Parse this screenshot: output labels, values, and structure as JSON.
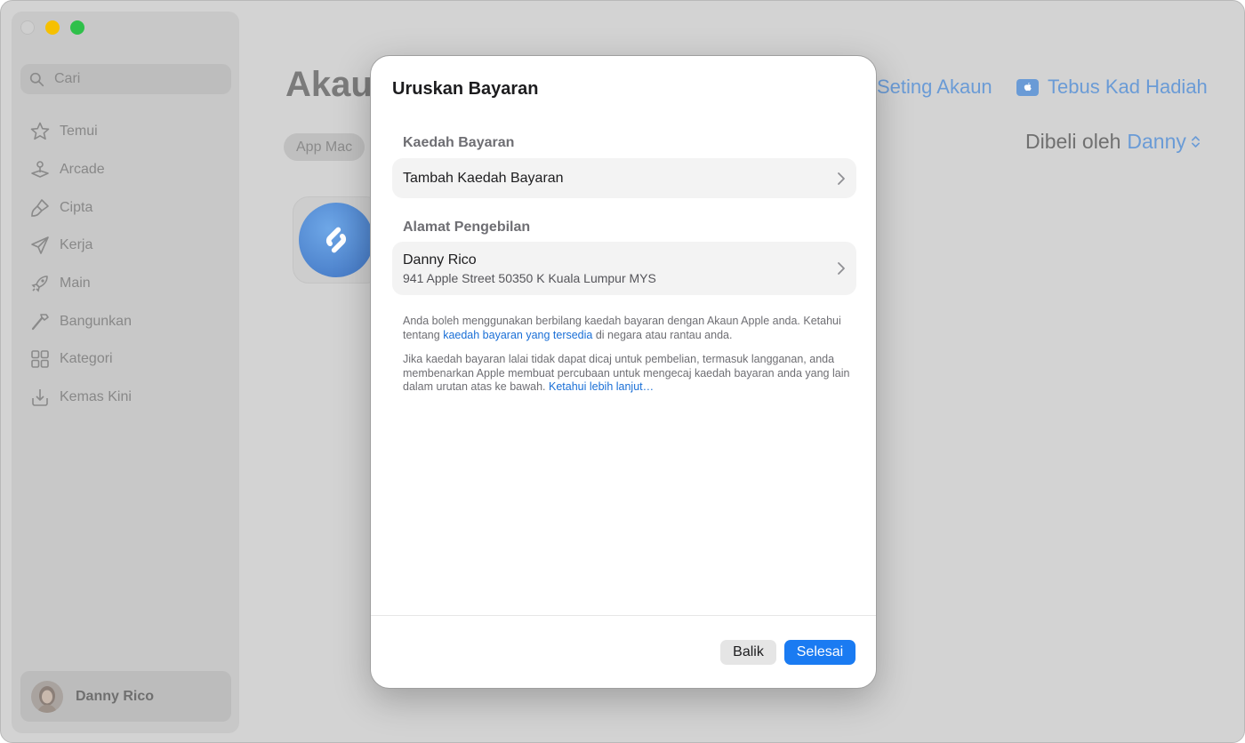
{
  "sidebar": {
    "search_placeholder": "Cari",
    "items": [
      {
        "label": "Temui",
        "icon": "star-icon"
      },
      {
        "label": "Arcade",
        "icon": "joystick-icon"
      },
      {
        "label": "Cipta",
        "icon": "paintbrush-icon"
      },
      {
        "label": "Kerja",
        "icon": "paperplane-icon"
      },
      {
        "label": "Main",
        "icon": "rocket-icon"
      },
      {
        "label": "Bangunkan",
        "icon": "hammer-icon"
      },
      {
        "label": "Kategori",
        "icon": "grid-icon"
      },
      {
        "label": "Kemas Kini",
        "icon": "download-tray-icon"
      }
    ],
    "user_name": "Danny Rico"
  },
  "main": {
    "title": "Akaun",
    "segment_label": "App Mac",
    "account_settings_label": "Seting Akaun",
    "redeem_label": "Tebus Kad Hadiah",
    "purchased_by_prefix": "Dibeli oleh",
    "purchased_by_name": "Danny"
  },
  "modal": {
    "title": "Uruskan Bayaran",
    "payment_section_label": "Kaedah Bayaran",
    "add_payment_label": "Tambah Kaedah Bayaran",
    "billing_section_label": "Alamat Pengebilan",
    "billing_name": "Danny Rico",
    "billing_address": "941 Apple Street 50350 K Kuala Lumpur MYS",
    "note1_text_a": "Anda boleh menggunakan berbilang kaedah bayaran dengan Akaun Apple anda. Ketahui tentang ",
    "note1_link": "kaedah bayaran yang tersedia",
    "note1_text_b": " di negara atau rantau anda.",
    "note2_text": "Jika kaedah bayaran lalai tidak dapat dicaj untuk pembelian, termasuk langganan, anda membenarkan Apple membuat percubaan untuk mengecaj kaedah bayaran anda yang lain dalam urutan atas ke bawah. ",
    "note2_link": "Ketahui lebih lanjut…",
    "back_label": "Balik",
    "done_label": "Selesai"
  },
  "colors": {
    "accent": "#1a7bf2",
    "link": "#1a6fd6",
    "dimmed_link": "#6a9bd6"
  }
}
